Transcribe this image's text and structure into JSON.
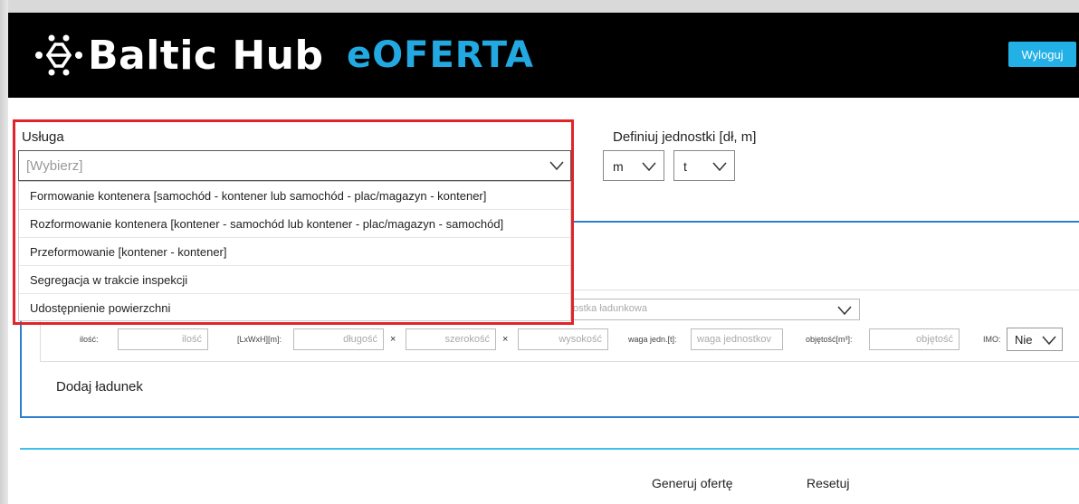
{
  "header": {
    "logo_text": "Baltic Hub",
    "app_name": "eOFERTA",
    "logout_label": "Wyloguj"
  },
  "service": {
    "label": "Usługa",
    "placeholder": "[Wybierz]",
    "options": [
      "Formowanie kontenera [samochód - kontener lub samochód - plac/magazyn - kontener]",
      "Rozformowanie kontenera [kontener - samochód lub kontener - plac/magazyn - samochód]",
      "Przeformowanie [kontener - kontener]",
      "Segregacja w trakcie inspekcji",
      "Udostępnienie powierzchni"
    ]
  },
  "units": {
    "label": "Definiuj jednostki [dł, m]",
    "length_value": "m",
    "weight_value": "t"
  },
  "cargo": {
    "unit_placeholder_partial": "ostka ładunkowa",
    "quantity_label": "ilość:",
    "quantity_placeholder": "ilość",
    "dims_label": "[LxWxH][m]:",
    "length_placeholder": "długość",
    "width_placeholder": "szerokość",
    "height_placeholder": "wysokość",
    "times_symbol": "×",
    "unit_weight_label": "waga jedn.[t]:",
    "unit_weight_placeholder": "waga jednostkov",
    "volume_label": "objętość[m³]:",
    "volume_placeholder": "objętość",
    "imo_label": "IMO:",
    "imo_value": "Nie",
    "add_label": "Dodaj ładunek"
  },
  "actions": {
    "generate_label": "Generuj ofertę",
    "reset_label": "Resetuj"
  },
  "colors": {
    "header_bg": "#000000",
    "accent": "#23a9e1",
    "highlight": "#e0242a",
    "box_border": "#2b7fd1"
  }
}
